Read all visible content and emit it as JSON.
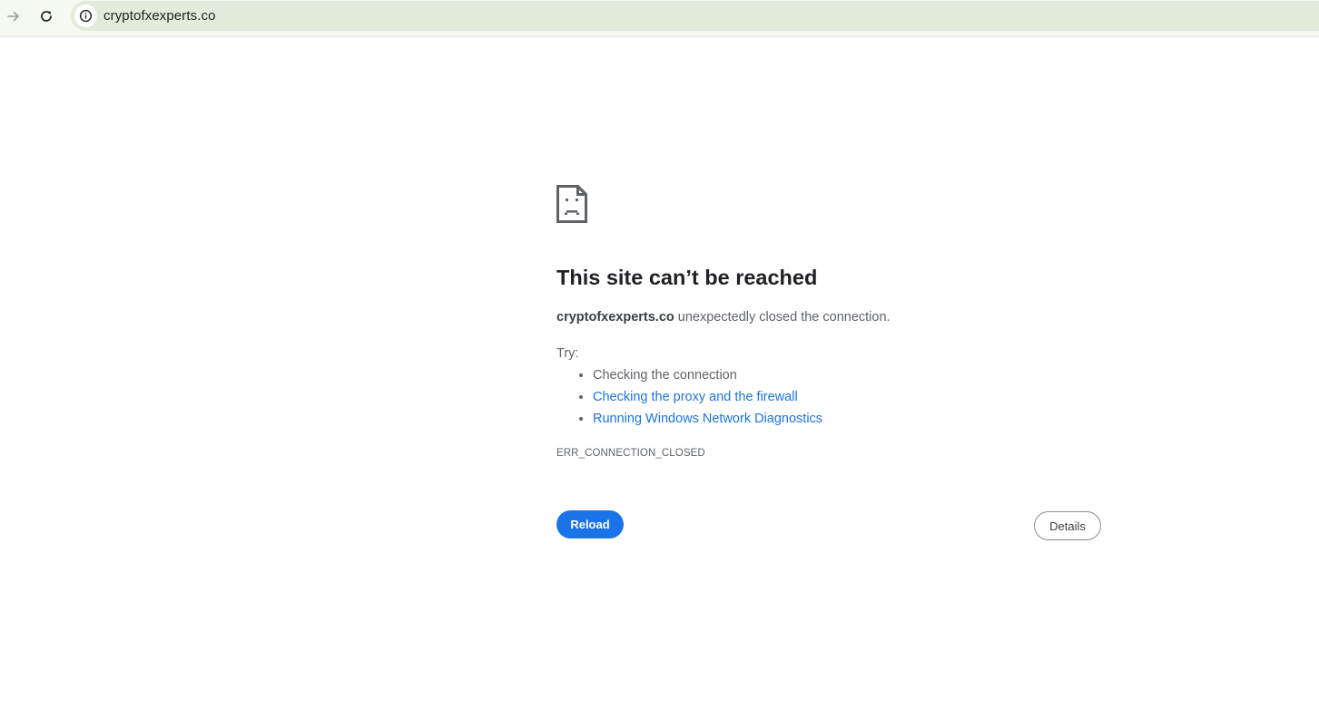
{
  "browser": {
    "url": "cryptofxexperts.co",
    "icons": {
      "forward": "arrow-forward-icon",
      "reload": "reload-icon",
      "site_info": "info-icon"
    },
    "colors": {
      "toolbar_bg": "#f6f9f2",
      "omnibox_bg": "#e3ebdb"
    }
  },
  "error_page": {
    "icon": "sad-page-icon",
    "heading": "This site can’t be reached",
    "summary_host": "cryptofxexperts.co",
    "summary_text": " unexpectedly closed the connection.",
    "try_label": "Try:",
    "suggestions": [
      {
        "text": "Checking the connection",
        "is_link": false
      },
      {
        "text": "Checking the proxy and the firewall",
        "is_link": true
      },
      {
        "text": "Running Windows Network Diagnostics",
        "is_link": true
      }
    ],
    "error_code": "ERR_CONNECTION_CLOSED",
    "reload_label": "Reload",
    "details_label": "Details",
    "colors": {
      "accent": "#1a73e8",
      "text": "#5f6368",
      "heading": "#202124"
    }
  }
}
